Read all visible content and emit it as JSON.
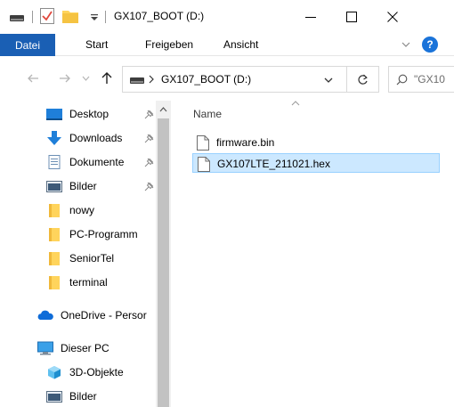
{
  "window": {
    "title": "GX107_BOOT (D:)"
  },
  "ribbon": {
    "tabs": [
      {
        "label": "Datei"
      },
      {
        "label": "Start"
      },
      {
        "label": "Freigeben"
      },
      {
        "label": "Ansicht"
      }
    ],
    "help_label": "?"
  },
  "address": {
    "path": "GX107_BOOT (D:)",
    "search_placeholder": "\"GX10"
  },
  "navigation": {
    "items": [
      {
        "label": "Desktop",
        "icon": "desktop-icon",
        "pinned": true
      },
      {
        "label": "Downloads",
        "icon": "download-arrow-icon",
        "pinned": true
      },
      {
        "label": "Dokumente",
        "icon": "document-icon",
        "pinned": true
      },
      {
        "label": "Bilder",
        "icon": "pictures-icon",
        "pinned": true
      },
      {
        "label": "nowy",
        "icon": "folder-icon",
        "pinned": false
      },
      {
        "label": "PC-Programm",
        "icon": "folder-icon",
        "pinned": false
      },
      {
        "label": "SeniorTel",
        "icon": "folder-icon",
        "pinned": false
      },
      {
        "label": "terminal",
        "icon": "folder-icon",
        "pinned": false
      },
      {
        "label": "OneDrive - Persor",
        "icon": "onedrive-cloud-icon",
        "pinned": false
      },
      {
        "label": "Dieser PC",
        "icon": "computer-icon",
        "pinned": false
      },
      {
        "label": "3D-Objekte",
        "icon": "3d-objects-icon",
        "pinned": false
      },
      {
        "label": "Bilder",
        "icon": "pictures-icon",
        "pinned": false
      }
    ]
  },
  "files": {
    "column_name": "Name",
    "items": [
      {
        "name": "firmware.bin",
        "selected": false
      },
      {
        "name": "GX107LTE_211021.hex",
        "selected": true
      }
    ]
  },
  "colors": {
    "accent": "#1a5fb4",
    "selection": "#cce8ff",
    "folder": "#ffd45c"
  }
}
